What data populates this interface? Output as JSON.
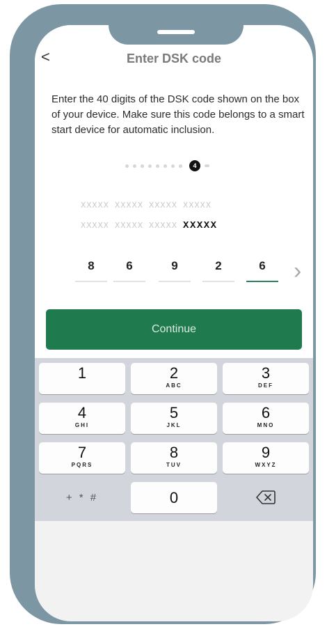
{
  "nav": {
    "back": "<",
    "title": "Enter DSK code"
  },
  "instructions": "Enter the 40 digits of the DSK code shown on the box of your device. Make sure this code belongs to a smart start device for automatic inclusion.",
  "progress": {
    "current_badge": "4"
  },
  "code": {
    "line1": [
      "XXXXX",
      "XXXXX",
      "XXXXX",
      "XXXXX"
    ],
    "line2": [
      "XXXXX",
      "XXXXX",
      "XXXXX",
      "XXXXX"
    ]
  },
  "digits": [
    "8",
    "6",
    "9",
    "2",
    "6"
  ],
  "next_chevron": "›",
  "continue_label": "Continue",
  "keyboard": {
    "keys": [
      {
        "num": "1",
        "letters": ""
      },
      {
        "num": "2",
        "letters": "ABC"
      },
      {
        "num": "3",
        "letters": "DEF"
      },
      {
        "num": "4",
        "letters": "GHI"
      },
      {
        "num": "5",
        "letters": "JKL"
      },
      {
        "num": "6",
        "letters": "MNO"
      },
      {
        "num": "7",
        "letters": "PQRS"
      },
      {
        "num": "8",
        "letters": "TUV"
      },
      {
        "num": "9",
        "letters": "WXYZ"
      }
    ],
    "symbols": "+ * #",
    "zero": "0",
    "backspace_icon": "backspace-icon"
  },
  "colors": {
    "accent": "#1f7a4e",
    "frame": "#7d96a3",
    "underline_active": "#2e7d5b"
  }
}
